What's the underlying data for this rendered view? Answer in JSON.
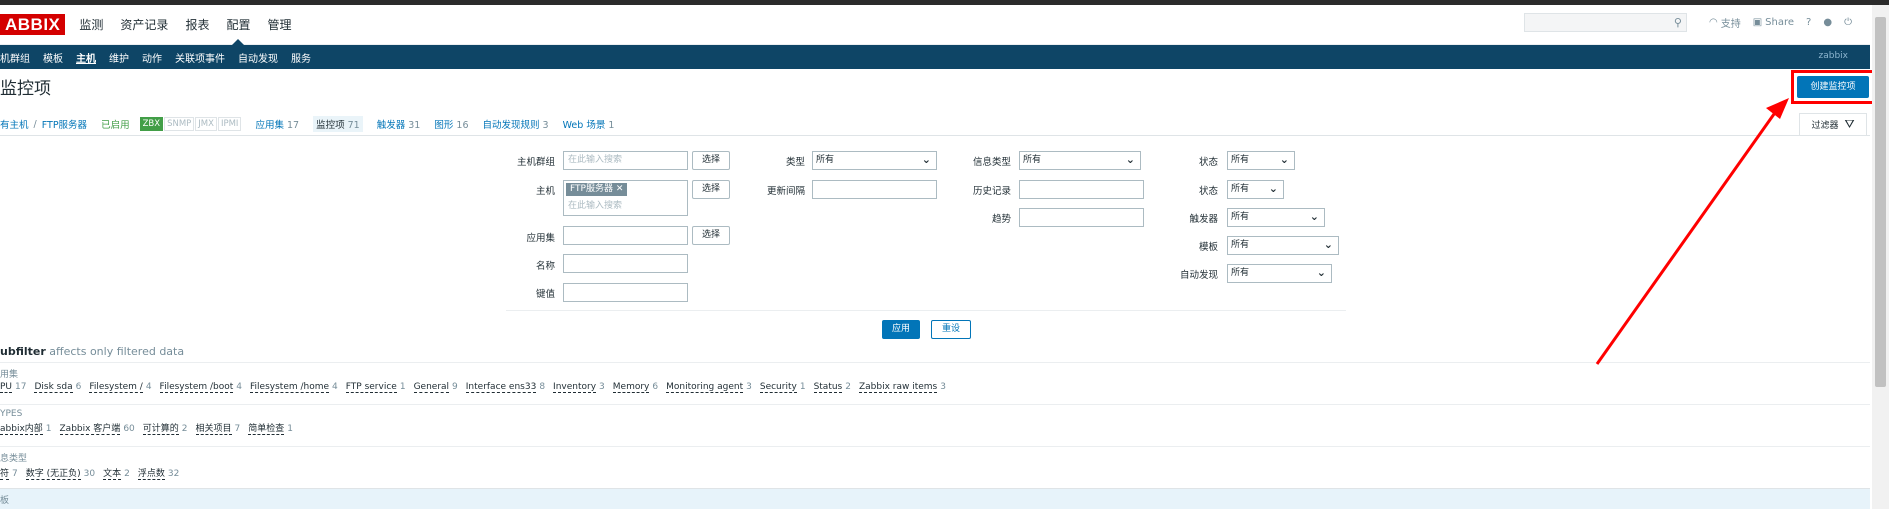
{
  "header": {
    "logo": "ABBIX",
    "nav": [
      "监测",
      "资产记录",
      "报表",
      "配置",
      "管理"
    ],
    "selected_nav": "配置",
    "links": {
      "support": "支持",
      "share": "Share",
      "help": "?",
      "user_icon": "user-icon",
      "logout_icon": "power-icon"
    }
  },
  "subnav": {
    "items": [
      "机群组",
      "模板",
      "主机",
      "维护",
      "动作",
      "关联项事件",
      "自动发现",
      "服务"
    ],
    "selected": "主机",
    "user": "zabbix"
  },
  "page": {
    "title": "监控项",
    "create_button": "创建监控项"
  },
  "breadcrumb": {
    "all_hosts": "有主机",
    "host": "FTP服务器",
    "enabled": "已启用",
    "availability": [
      "ZBX",
      "SNMP",
      "JMX",
      "IPMI"
    ],
    "tabs": [
      {
        "label": "应用集",
        "count": "17"
      },
      {
        "label": "监控项",
        "count": "71"
      },
      {
        "label": "触发器",
        "count": "31"
      },
      {
        "label": "图形",
        "count": "16"
      },
      {
        "label": "自动发现规则",
        "count": "3"
      },
      {
        "label": "Web 场景",
        "count": "1"
      }
    ]
  },
  "filter": {
    "tab_label": "过滤器",
    "host_group_label": "主机群组",
    "host_group_placeholder": "在此输入搜索",
    "host_label": "主机",
    "host_tag": "FTP服务器",
    "host_placeholder": "在此输入搜索",
    "app_label": "应用集",
    "name_label": "名称",
    "key_label": "键值",
    "select_label": "选择",
    "type_label": "类型",
    "type_value": "所有",
    "update_interval_label": "更新间隔",
    "info_type_label": "信息类型",
    "info_type_value": "所有",
    "history_label": "历史记录",
    "trends_label": "趋势",
    "status1_label": "状态",
    "status1_value": "所有",
    "status2_label": "状态",
    "status2_value": "所有",
    "triggers_label": "触发器",
    "triggers_value": "所有",
    "template_label": "模板",
    "template_value": "所有",
    "discovery_label": "自动发现",
    "discovery_value": "所有",
    "apply": "应用",
    "reset": "重设"
  },
  "subfilter": {
    "title": "ubfilter",
    "note": "affects only filtered data",
    "groups": [
      {
        "header": "用集",
        "items": [
          {
            "name": "PU",
            "count": "17"
          },
          {
            "name": "Disk sda",
            "count": "6"
          },
          {
            "name": "Filesystem /",
            "count": "4"
          },
          {
            "name": "Filesystem /boot",
            "count": "4"
          },
          {
            "name": "Filesystem /home",
            "count": "4"
          },
          {
            "name": "FTP service",
            "count": "1"
          },
          {
            "name": "General",
            "count": "9"
          },
          {
            "name": "Interface ens33",
            "count": "8"
          },
          {
            "name": "Inventory",
            "count": "3"
          },
          {
            "name": "Memory",
            "count": "6"
          },
          {
            "name": "Monitoring agent",
            "count": "3"
          },
          {
            "name": "Security",
            "count": "1"
          },
          {
            "name": "Status",
            "count": "2"
          },
          {
            "name": "Zabbix raw items",
            "count": "3"
          }
        ]
      },
      {
        "header": "YPES",
        "items": [
          {
            "name": "abbix内部",
            "count": "1"
          },
          {
            "name": "Zabbix 客户端",
            "count": "60"
          },
          {
            "name": "可计算的",
            "count": "2"
          },
          {
            "name": "相关项目",
            "count": "7"
          },
          {
            "name": "简单检查",
            "count": "1"
          }
        ]
      },
      {
        "header": "息类型",
        "items": [
          {
            "name": "符",
            "count": "7"
          },
          {
            "name": "数字 (无正负)",
            "count": "30"
          },
          {
            "name": "文本",
            "count": "2"
          },
          {
            "name": "浮点数",
            "count": "32"
          }
        ]
      }
    ],
    "last_header": "板"
  }
}
